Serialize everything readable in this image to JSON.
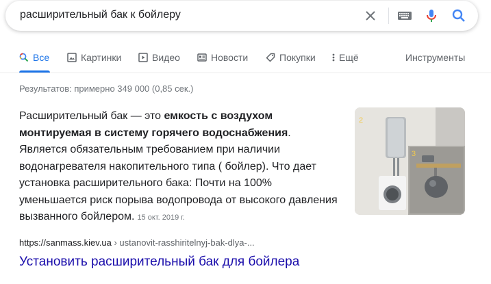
{
  "search": {
    "query": "расширительный бак к бойлеру"
  },
  "tabs": [
    {
      "label": "Все",
      "icon": "search-icon",
      "active": true
    },
    {
      "label": "Картинки",
      "icon": "image-icon",
      "active": false
    },
    {
      "label": "Видео",
      "icon": "video-icon",
      "active": false
    },
    {
      "label": "Новости",
      "icon": "news-icon",
      "active": false
    },
    {
      "label": "Покупки",
      "icon": "tag-icon",
      "active": false
    },
    {
      "label": "Ещё",
      "icon": "more-vert-icon",
      "active": false
    }
  ],
  "tools_label": "Инструменты",
  "stats": "Результатов: примерно 349 000 (0,85 сек.)",
  "snippet": {
    "intro": "Расширительный бак — это ",
    "bold": "емкость с воздухом монтируемая в систему горячего водоснабжения",
    "rest": ". Является обязательным требованием при наличии водонагревателя накопительного типа ( бойлер). Что дает установка расширительного бака: Почти на 100% уменьшается риск порыва водопровода от высокого давления вызванного бойлером.",
    "date": "15 окт. 2019 г.",
    "image_labels": [
      "2",
      "3"
    ]
  },
  "result": {
    "domain": "https://sanmass.kiev.ua",
    "path": " › ustanovit-rasshiritelnyj-bak-dlya-...",
    "title": "Установить расширительный бак для бойлера"
  },
  "colors": {
    "accent": "#1a73e8",
    "link": "#1a0dab",
    "muted": "#70757a",
    "mic_red": "#ea4335"
  }
}
